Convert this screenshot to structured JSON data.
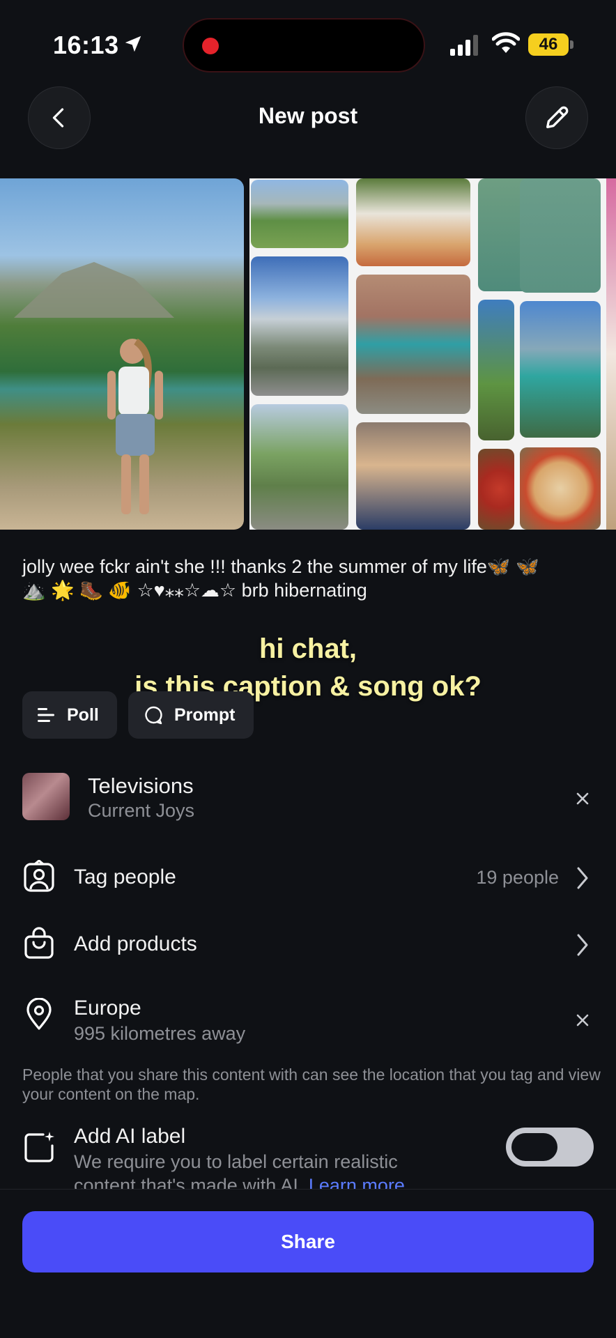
{
  "status_bar": {
    "time": "16:13",
    "battery": "46",
    "colors": {
      "battery": "#f5cf1f",
      "recording": "#e5232b"
    },
    "icons": [
      "location-arrow-icon",
      "cellular-signal-icon",
      "wifi-icon",
      "battery-icon"
    ]
  },
  "header": {
    "title": "New post",
    "back_icon": "chevron-left-icon",
    "edit_icon": "pencil-icon"
  },
  "carousel": {
    "photos": [
      "photo-main-girl-mountains",
      "collage-mountain-valley",
      "collage-pizza-picnic",
      "collage-swimming-lake",
      "collage-road-mountains",
      "collage-outfit-brick-wall",
      "collage-running-road",
      "collage-group-selfie",
      "collage-pizza"
    ]
  },
  "caption": {
    "text": "jolly wee fckr ain't she !!! thanks 2 the summer of my life",
    "emoji_line_1": "🦋 🦋",
    "emoji_line_2": "⛰️ 🌟 🥾 🐠 ☆♥⁎⁎☆☁☆",
    "text_2": "brb hibernating"
  },
  "overlay": {
    "line1": "hi chat,",
    "line2": "is this caption & song ok?",
    "color": "#f7f1a2"
  },
  "chips": {
    "poll": "Poll",
    "prompt": "Prompt"
  },
  "music": {
    "title": "Televisions",
    "artist": "Current Joys"
  },
  "tag_people": {
    "label": "Tag people",
    "value": "19 people"
  },
  "add_products": {
    "label": "Add products"
  },
  "location": {
    "name": "Europe",
    "distance": "995 kilometres away",
    "note": "People that you share this content with can see the location that you tag and view your content on the map."
  },
  "ai_label": {
    "title": "Add AI label",
    "description": "We require you to label certain realistic content that's made with AI.",
    "learn_more": "Learn more",
    "enabled": false
  },
  "share": {
    "label": "Share",
    "color": "#4a4cf8"
  }
}
